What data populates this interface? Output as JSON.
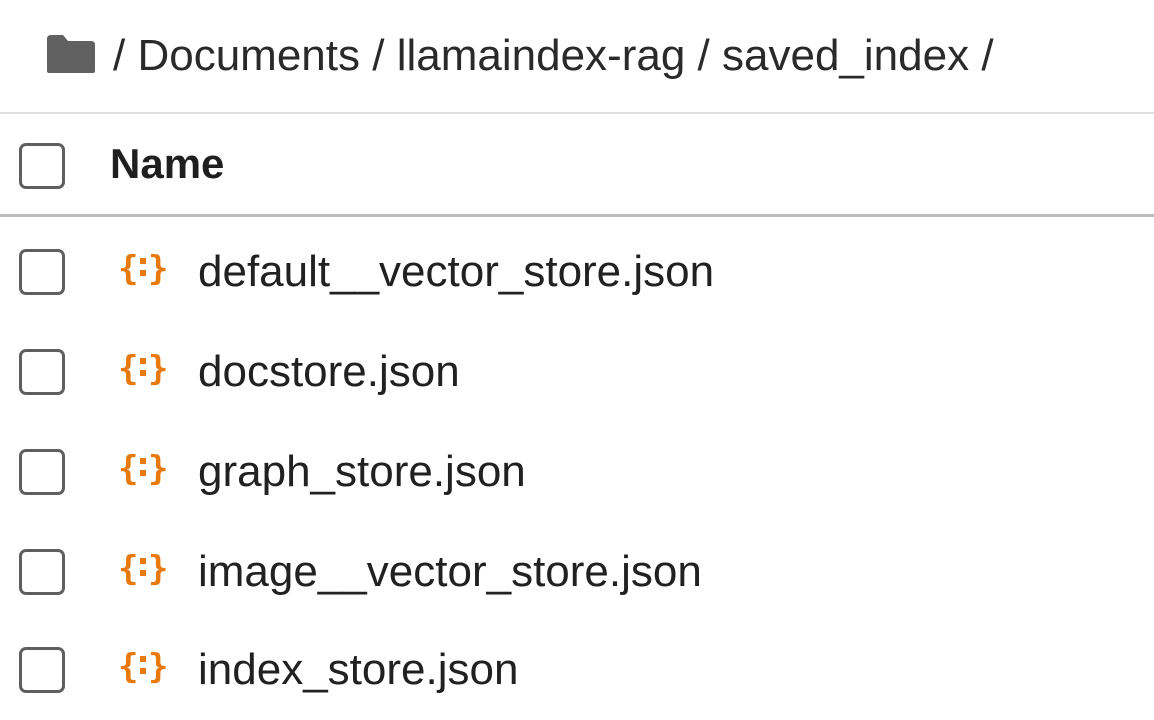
{
  "breadcrumb": {
    "folder_icon": "folder-icon",
    "parts": [
      "Documents",
      "llamaindex-rag",
      "saved_index"
    ],
    "separator": "/"
  },
  "table": {
    "header": {
      "name_label": "Name"
    },
    "files": [
      {
        "name": "default__vector_store.json",
        "icon": "json-file-icon"
      },
      {
        "name": "docstore.json",
        "icon": "json-file-icon"
      },
      {
        "name": "graph_store.json",
        "icon": "json-file-icon"
      },
      {
        "name": "image__vector_store.json",
        "icon": "json-file-icon"
      },
      {
        "name": "index_store.json",
        "icon": "json-file-icon"
      }
    ]
  },
  "colors": {
    "json_icon": "#e8790c",
    "folder_icon": "#616161",
    "checkbox_border": "#5f5f5f"
  }
}
